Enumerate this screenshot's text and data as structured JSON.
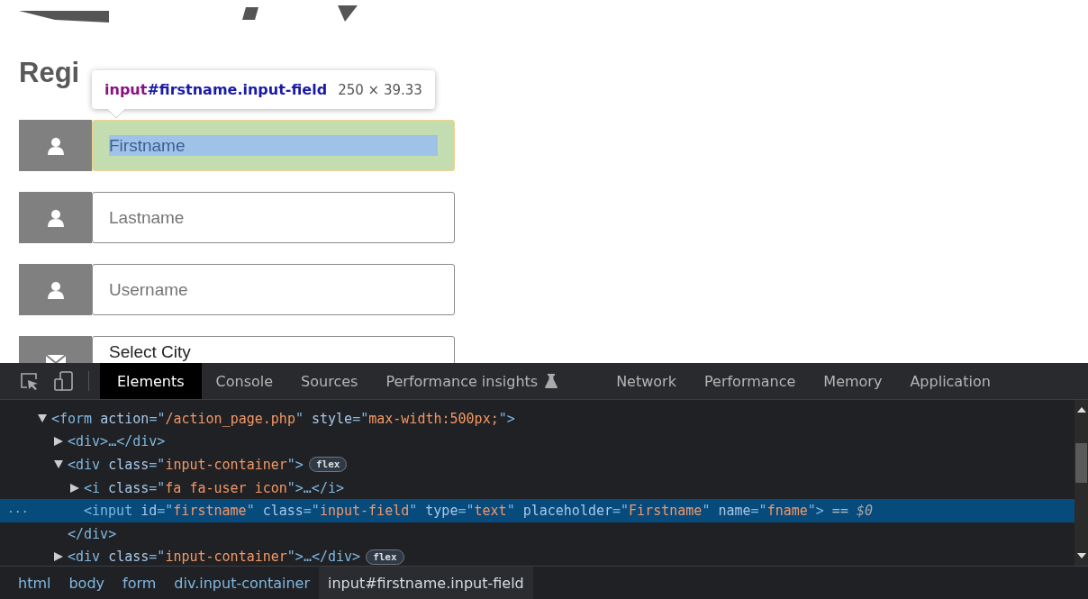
{
  "page": {
    "heading": "Regi",
    "tooltip": {
      "tag": "input",
      "selector": "#firstname.input-field",
      "size": "250 × 39.33"
    },
    "fields": [
      {
        "kind": "text",
        "placeholder": "Firstname",
        "highlighted": true
      },
      {
        "kind": "text",
        "placeholder": "Lastname",
        "highlighted": false
      },
      {
        "kind": "text",
        "placeholder": "Username",
        "highlighted": false
      },
      {
        "kind": "select",
        "value": "Select City",
        "highlighted": false
      }
    ]
  },
  "devtools": {
    "tabs": [
      {
        "kind": "plain",
        "label": "Elements",
        "selected": true
      },
      {
        "kind": "plain",
        "label": "Console",
        "selected": false
      },
      {
        "kind": "plain",
        "label": "Sources",
        "selected": false
      },
      {
        "kind": "experimental",
        "label": "Performance insights",
        "selected": false
      },
      {
        "kind": "plain",
        "label": "Network",
        "selected": false
      },
      {
        "kind": "plain",
        "label": "Performance",
        "selected": false
      },
      {
        "kind": "plain",
        "label": "Memory",
        "selected": false
      },
      {
        "kind": "plain",
        "label": "Application",
        "selected": false
      }
    ],
    "tree": [
      {
        "expanded": true,
        "selected": false,
        "tokens": [
          {
            "kind": "tag",
            "text": "<form "
          },
          {
            "kind": "attr",
            "text": "action"
          },
          {
            "kind": "tag",
            "text": "=\""
          },
          {
            "kind": "value",
            "text": "/action_page.php"
          },
          {
            "kind": "tag",
            "text": "\" "
          },
          {
            "kind": "attr",
            "text": "style"
          },
          {
            "kind": "tag",
            "text": "=\""
          },
          {
            "kind": "value",
            "text": "max-width:500px;"
          },
          {
            "kind": "tag",
            "text": "\">"
          }
        ],
        "children": [
          {
            "expanded": false,
            "selected": false,
            "tokens": [
              {
                "kind": "tag",
                "text": "<div>…</div>"
              }
            ]
          },
          {
            "expanded": true,
            "selected": false,
            "badge": "flex",
            "tokens": [
              {
                "kind": "tag",
                "text": "<div "
              },
              {
                "kind": "attr",
                "text": "class"
              },
              {
                "kind": "tag",
                "text": "=\""
              },
              {
                "kind": "value",
                "text": "input-container"
              },
              {
                "kind": "tag",
                "text": "\">"
              }
            ],
            "children": [
              {
                "expanded": false,
                "selected": false,
                "tokens": [
                  {
                    "kind": "tag",
                    "text": "<i "
                  },
                  {
                    "kind": "attr",
                    "text": "class"
                  },
                  {
                    "kind": "tag",
                    "text": "=\""
                  },
                  {
                    "kind": "value",
                    "text": "fa fa-user icon"
                  },
                  {
                    "kind": "tag",
                    "text": "\">…</i>"
                  }
                ]
              },
              {
                "selected": true,
                "gutter": "···",
                "tokens": [
                  {
                    "kind": "tag",
                    "text": "<input "
                  },
                  {
                    "kind": "attr",
                    "text": "id"
                  },
                  {
                    "kind": "tag",
                    "text": "=\""
                  },
                  {
                    "kind": "value",
                    "text": "firstname"
                  },
                  {
                    "kind": "tag",
                    "text": "\" "
                  },
                  {
                    "kind": "attr",
                    "text": "class"
                  },
                  {
                    "kind": "tag",
                    "text": "=\""
                  },
                  {
                    "kind": "value",
                    "text": "input-field"
                  },
                  {
                    "kind": "tag",
                    "text": "\" "
                  },
                  {
                    "kind": "attr",
                    "text": "type"
                  },
                  {
                    "kind": "tag",
                    "text": "=\""
                  },
                  {
                    "kind": "value",
                    "text": "text"
                  },
                  {
                    "kind": "tag",
                    "text": "\" "
                  },
                  {
                    "kind": "attr",
                    "text": "placeholder"
                  },
                  {
                    "kind": "tag",
                    "text": "=\""
                  },
                  {
                    "kind": "value",
                    "text": "Firstname"
                  },
                  {
                    "kind": "tag",
                    "text": "\" "
                  },
                  {
                    "kind": "attr",
                    "text": "name"
                  },
                  {
                    "kind": "tag",
                    "text": "=\""
                  },
                  {
                    "kind": "value",
                    "text": "fname"
                  },
                  {
                    "kind": "tag",
                    "text": "\">"
                  },
                  {
                    "kind": "plain",
                    "text": " == "
                  },
                  {
                    "kind": "ref",
                    "text": "$0"
                  }
                ]
              }
            ],
            "closing": [
              {
                "kind": "tag",
                "text": "</div>"
              }
            ]
          },
          {
            "expanded": false,
            "selected": false,
            "badge": "flex",
            "tokens": [
              {
                "kind": "tag",
                "text": "<div "
              },
              {
                "kind": "attr",
                "text": "class"
              },
              {
                "kind": "tag",
                "text": "=\""
              },
              {
                "kind": "value",
                "text": "input-container"
              },
              {
                "kind": "tag",
                "text": "\">…</div>"
              }
            ]
          }
        ]
      }
    ],
    "breadcrumbs": [
      {
        "label": "html",
        "selected": false
      },
      {
        "label": "body",
        "selected": false
      },
      {
        "label": "form",
        "selected": false
      },
      {
        "label": "div.input-container",
        "selected": false
      },
      {
        "label": "input#firstname.input-field",
        "selected": true
      }
    ]
  }
}
